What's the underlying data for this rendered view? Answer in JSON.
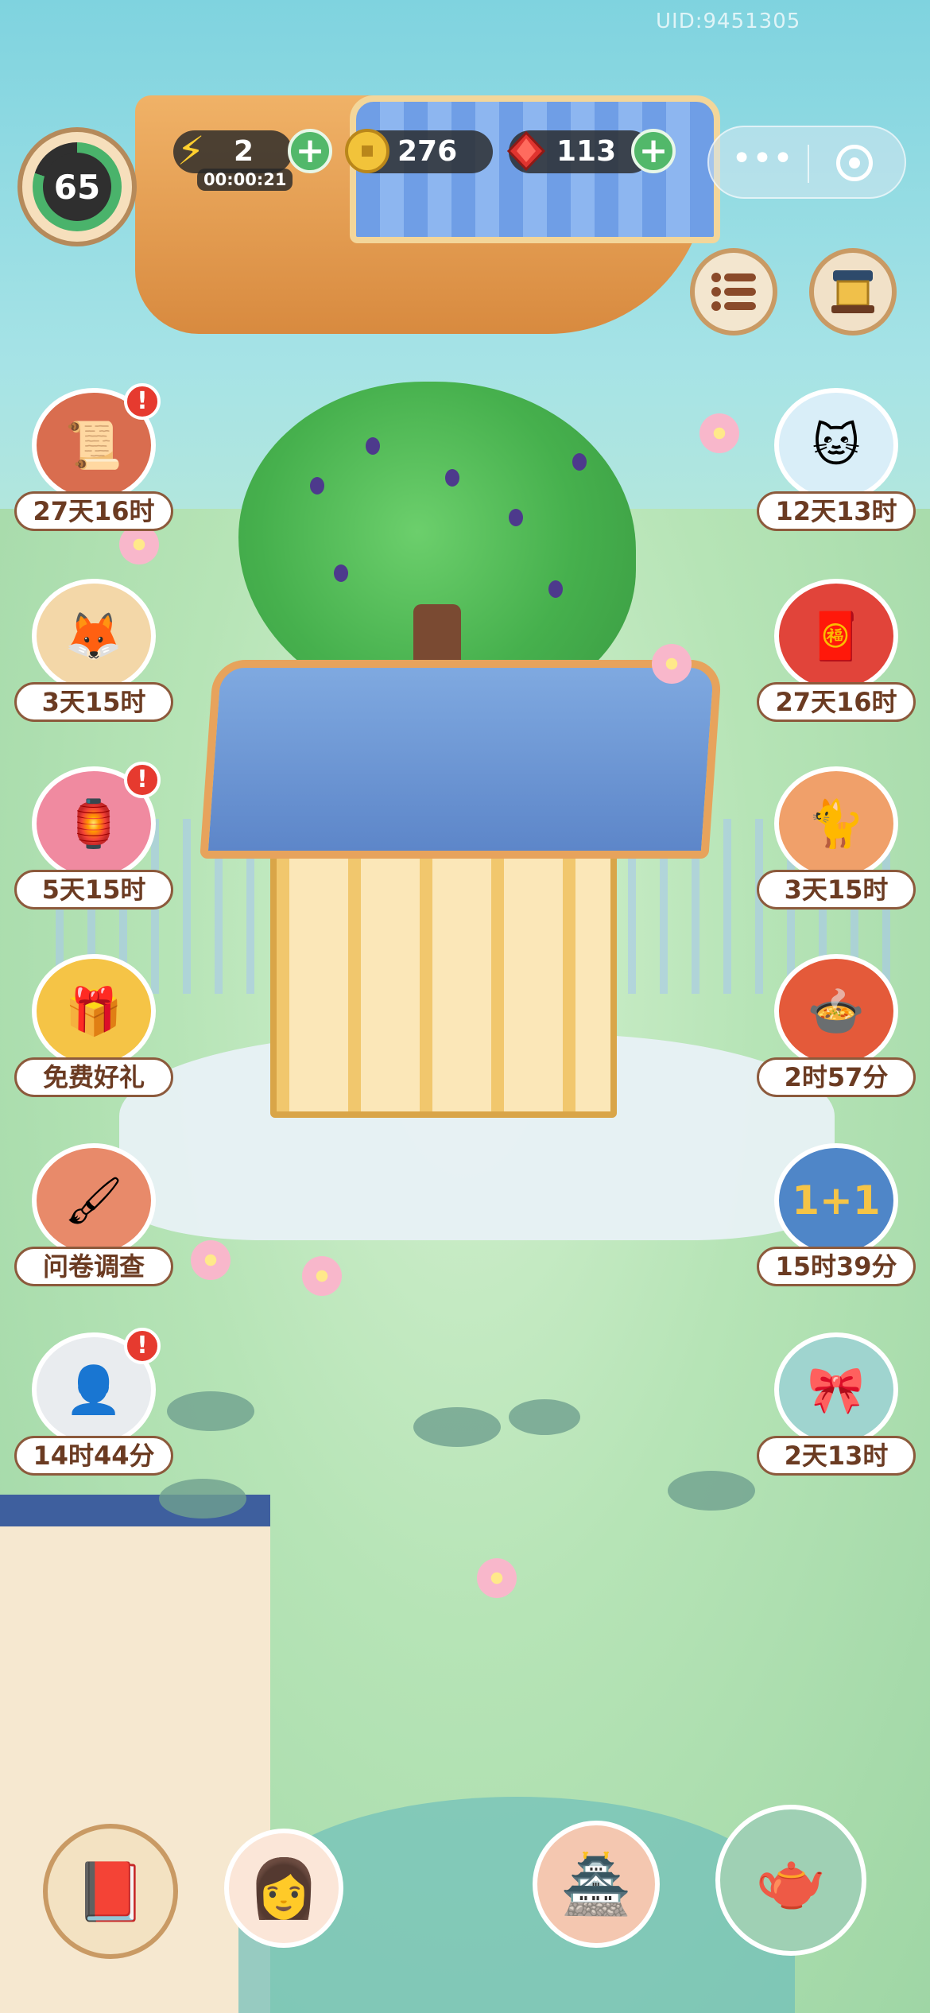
{
  "watermark": "UID:9451305",
  "hud": {
    "level": "65",
    "energy": {
      "value": "2",
      "timer": "00:00:21",
      "icon": "lightning-icon"
    },
    "coins": {
      "value": "276",
      "icon": "coin-icon"
    },
    "gems": {
      "value": "113",
      "icon": "gem-icon"
    },
    "plus_label": "+",
    "capsule_dots": "•••"
  },
  "left_events": [
    {
      "label": "27天16时",
      "icon": "scroll-gift-icon",
      "alert": "!"
    },
    {
      "label": "3天15时",
      "icon": "fox-icon"
    },
    {
      "label": "5天15时",
      "icon": "lantern-wheel-icon",
      "alert": "!"
    },
    {
      "label": "免费好礼",
      "icon": "gift-compass-icon"
    },
    {
      "label": "问卷调查",
      "icon": "survey-scroll-icon"
    },
    {
      "label": "14时44分",
      "icon": "character-hat-icon",
      "alert": "!"
    }
  ],
  "right_events": [
    {
      "label": "12天13时",
      "icon": "cat-cloud-icon"
    },
    {
      "label": "27天16时",
      "icon": "fan-fortune-icon"
    },
    {
      "label": "3天15时",
      "icon": "cat-fan-icon"
    },
    {
      "label": "2时57分",
      "icon": "feast-icon"
    },
    {
      "label": "15时39分",
      "icon": "plus-one-icon"
    },
    {
      "label": "2天13时",
      "icon": "cat-giftbox-icon"
    }
  ],
  "colors": {
    "accent_green": "#52b86a",
    "alert_red": "#e63a2f",
    "label_brown": "#6b3b22"
  }
}
